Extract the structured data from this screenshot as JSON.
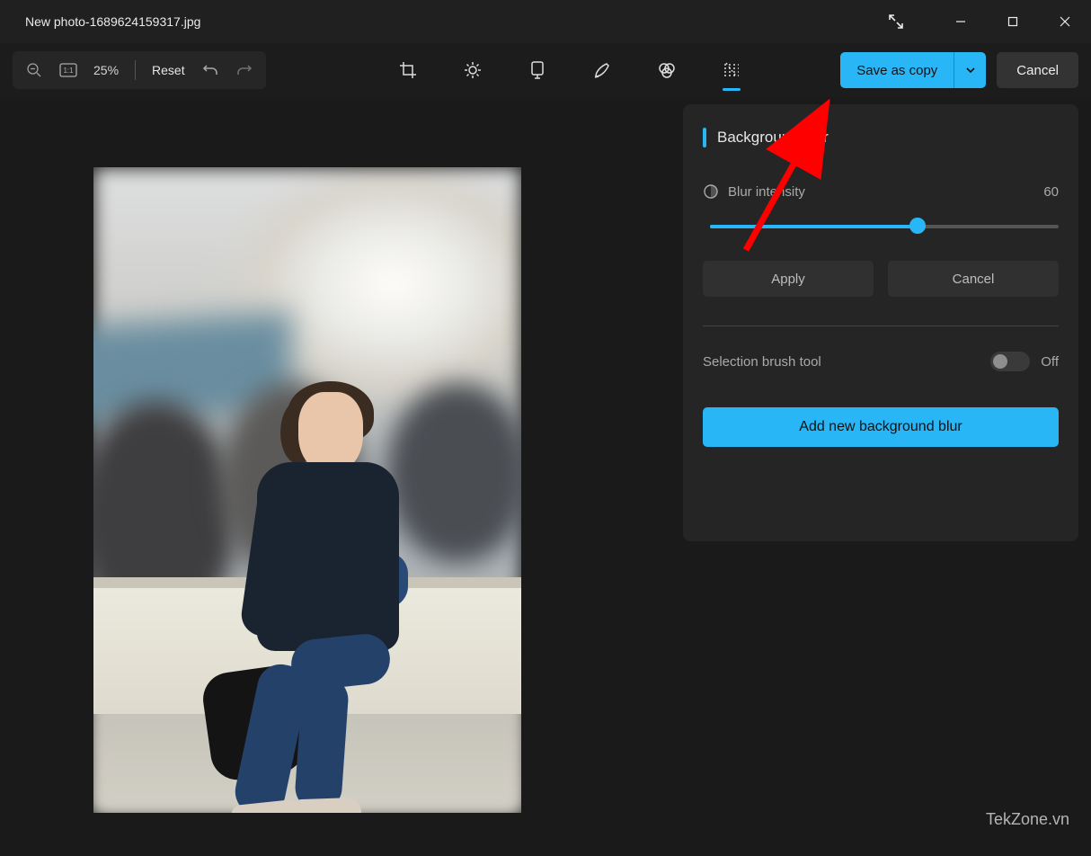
{
  "titlebar": {
    "filename": "New photo-1689624159317.jpg"
  },
  "toolbar": {
    "zoom_value": "25%",
    "reset_label": "Reset"
  },
  "actions": {
    "save_label": "Save as copy",
    "cancel_label": "Cancel"
  },
  "panel": {
    "title": "Background blur",
    "blur_intensity_label": "Blur intensity",
    "blur_intensity_value": "60",
    "apply_label": "Apply",
    "cancel_label": "Cancel",
    "selection_brush_label": "Selection brush tool",
    "toggle_state": "Off",
    "add_new_label": "Add new background blur"
  },
  "watermark": "TekZone.vn"
}
